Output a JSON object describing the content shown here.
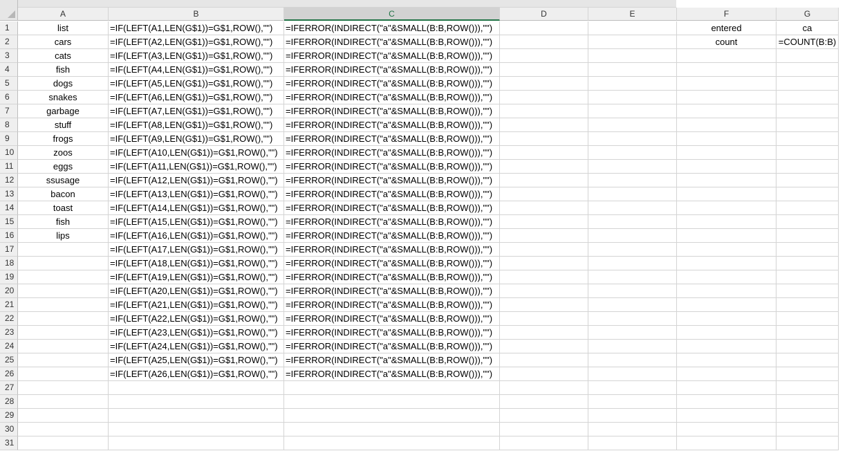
{
  "columns": [
    "A",
    "B",
    "C",
    "D",
    "E",
    "F",
    "G"
  ],
  "rows": [
    "1",
    "2",
    "3",
    "4",
    "5",
    "6",
    "7",
    "8",
    "9",
    "10",
    "11",
    "12",
    "13",
    "14",
    "15",
    "16",
    "17",
    "18",
    "19",
    "20",
    "21",
    "22",
    "23",
    "24",
    "25",
    "26",
    "27",
    "28",
    "29",
    "30",
    "31"
  ],
  "column_a": [
    "list",
    "cars",
    "cats",
    "fish",
    "dogs",
    "snakes",
    "garbage",
    "stuff",
    "frogs",
    "zoos",
    "eggs",
    "ssusage",
    "bacon",
    "toast",
    "fish",
    "lips"
  ],
  "column_b": [
    "=IF(LEFT(A1,LEN(G$1))=G$1,ROW(),\"\")",
    "=IF(LEFT(A2,LEN(G$1))=G$1,ROW(),\"\")",
    "=IF(LEFT(A3,LEN(G$1))=G$1,ROW(),\"\")",
    "=IF(LEFT(A4,LEN(G$1))=G$1,ROW(),\"\")",
    "=IF(LEFT(A5,LEN(G$1))=G$1,ROW(),\"\")",
    "=IF(LEFT(A6,LEN(G$1))=G$1,ROW(),\"\")",
    "=IF(LEFT(A7,LEN(G$1))=G$1,ROW(),\"\")",
    "=IF(LEFT(A8,LEN(G$1))=G$1,ROW(),\"\")",
    "=IF(LEFT(A9,LEN(G$1))=G$1,ROW(),\"\")",
    "=IF(LEFT(A10,LEN(G$1))=G$1,ROW(),\"\")",
    "=IF(LEFT(A11,LEN(G$1))=G$1,ROW(),\"\")",
    "=IF(LEFT(A12,LEN(G$1))=G$1,ROW(),\"\")",
    "=IF(LEFT(A13,LEN(G$1))=G$1,ROW(),\"\")",
    "=IF(LEFT(A14,LEN(G$1))=G$1,ROW(),\"\")",
    "=IF(LEFT(A15,LEN(G$1))=G$1,ROW(),\"\")",
    "=IF(LEFT(A16,LEN(G$1))=G$1,ROW(),\"\")",
    "=IF(LEFT(A17,LEN(G$1))=G$1,ROW(),\"\")",
    "=IF(LEFT(A18,LEN(G$1))=G$1,ROW(),\"\")",
    "=IF(LEFT(A19,LEN(G$1))=G$1,ROW(),\"\")",
    "=IF(LEFT(A20,LEN(G$1))=G$1,ROW(),\"\")",
    "=IF(LEFT(A21,LEN(G$1))=G$1,ROW(),\"\")",
    "=IF(LEFT(A22,LEN(G$1))=G$1,ROW(),\"\")",
    "=IF(LEFT(A23,LEN(G$1))=G$1,ROW(),\"\")",
    "=IF(LEFT(A24,LEN(G$1))=G$1,ROW(),\"\")",
    "=IF(LEFT(A25,LEN(G$1))=G$1,ROW(),\"\")",
    "=IF(LEFT(A26,LEN(G$1))=G$1,ROW(),\"\")"
  ],
  "column_c": [
    "=IFERROR(INDIRECT(\"a\"&SMALL(B:B,ROW())),\"\")",
    "=IFERROR(INDIRECT(\"a\"&SMALL(B:B,ROW())),\"\")",
    "=IFERROR(INDIRECT(\"a\"&SMALL(B:B,ROW())),\"\")",
    "=IFERROR(INDIRECT(\"a\"&SMALL(B:B,ROW())),\"\")",
    "=IFERROR(INDIRECT(\"a\"&SMALL(B:B,ROW())),\"\")",
    "=IFERROR(INDIRECT(\"a\"&SMALL(B:B,ROW())),\"\")",
    "=IFERROR(INDIRECT(\"a\"&SMALL(B:B,ROW())),\"\")",
    "=IFERROR(INDIRECT(\"a\"&SMALL(B:B,ROW())),\"\")",
    "=IFERROR(INDIRECT(\"a\"&SMALL(B:B,ROW())),\"\")",
    "=IFERROR(INDIRECT(\"a\"&SMALL(B:B,ROW())),\"\")",
    "=IFERROR(INDIRECT(\"a\"&SMALL(B:B,ROW())),\"\")",
    "=IFERROR(INDIRECT(\"a\"&SMALL(B:B,ROW())),\"\")",
    "=IFERROR(INDIRECT(\"a\"&SMALL(B:B,ROW())),\"\")",
    "=IFERROR(INDIRECT(\"a\"&SMALL(B:B,ROW())),\"\")",
    "=IFERROR(INDIRECT(\"a\"&SMALL(B:B,ROW())),\"\")",
    "=IFERROR(INDIRECT(\"a\"&SMALL(B:B,ROW())),\"\")",
    "=IFERROR(INDIRECT(\"a\"&SMALL(B:B,ROW())),\"\")",
    "=IFERROR(INDIRECT(\"a\"&SMALL(B:B,ROW())),\"\")",
    "=IFERROR(INDIRECT(\"a\"&SMALL(B:B,ROW())),\"\")",
    "=IFERROR(INDIRECT(\"a\"&SMALL(B:B,ROW())),\"\")",
    "=IFERROR(INDIRECT(\"a\"&SMALL(B:B,ROW())),\"\")",
    "=IFERROR(INDIRECT(\"a\"&SMALL(B:B,ROW())),\"\")",
    "=IFERROR(INDIRECT(\"a\"&SMALL(B:B,ROW())),\"\")",
    "=IFERROR(INDIRECT(\"a\"&SMALL(B:B,ROW())),\"\")",
    "=IFERROR(INDIRECT(\"a\"&SMALL(B:B,ROW())),\"\")",
    "=IFERROR(INDIRECT(\"a\"&SMALL(B:B,ROW())),\"\")"
  ],
  "column_f": [
    "entered",
    "count"
  ],
  "column_g": [
    "ca",
    "=COUNT(B:B)"
  ],
  "selected_column": "C",
  "colors": {
    "header_bg": "#efefef",
    "selected_header_bg": "#d2d2d2",
    "accent": "#217346",
    "gridline": "#d4d4d4"
  }
}
